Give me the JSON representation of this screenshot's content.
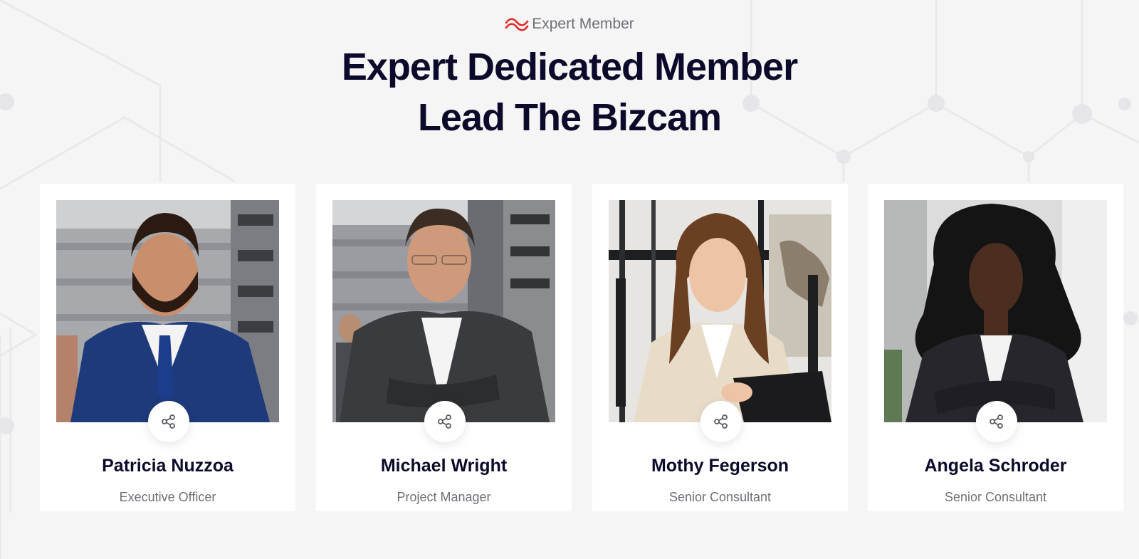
{
  "section": {
    "eyebrow": "Expert Member",
    "eyebrow_icon": "wave-icon",
    "title_line1": "Expert Dedicated Member",
    "title_line2": "Lead The Bizcam"
  },
  "team": [
    {
      "name": "Patricia Nuzzoa",
      "role": "Executive Officer",
      "photo": "man-in-blue-suit-portrait"
    },
    {
      "name": "Michael Wright",
      "role": "Project Manager",
      "photo": "man-in-grey-blazer-portrait"
    },
    {
      "name": "Mothy Fegerson",
      "role": "Senior Consultant",
      "photo": "woman-with-clipboard-portrait"
    },
    {
      "name": "Angela Schroder",
      "role": "Senior Consultant",
      "photo": "woman-in-dark-blazer-portrait"
    }
  ],
  "share_icon": "share-icon",
  "colors": {
    "background": "#f5f5f6",
    "heading": "#0b0a2a",
    "muted": "#6e6f75",
    "accent": "#e02a2a",
    "card": "#ffffff"
  }
}
